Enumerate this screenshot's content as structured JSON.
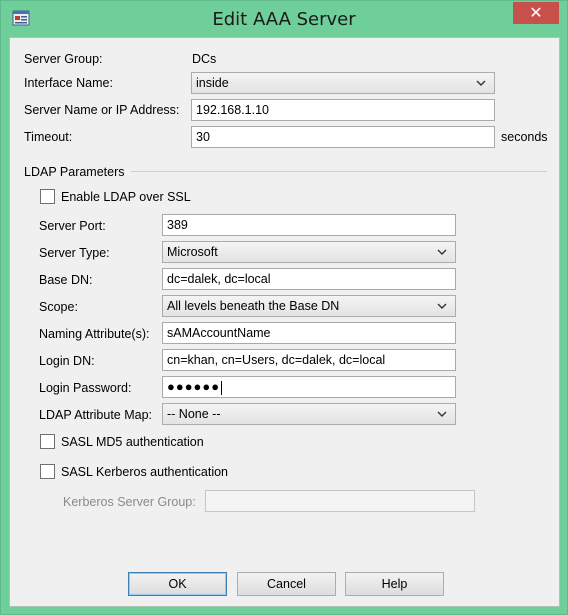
{
  "window": {
    "title": "Edit AAA Server",
    "close_glyph": "✕"
  },
  "server_group": {
    "label": "Server Group:",
    "value": "DCs"
  },
  "interface_name": {
    "label": "Interface Name:",
    "value": "inside"
  },
  "server_name": {
    "label": "Server Name or IP Address:",
    "value": "192.168.1.10"
  },
  "timeout": {
    "label": "Timeout:",
    "value": "30",
    "unit": "seconds"
  },
  "ldap": {
    "group_title": "LDAP Parameters",
    "enable_ssl": {
      "label": "Enable LDAP over SSL",
      "checked": false
    },
    "server_port": {
      "label": "Server Port:",
      "value": "389"
    },
    "server_type": {
      "label": "Server Type:",
      "value": "Microsoft"
    },
    "base_dn": {
      "label": "Base DN:",
      "value": "dc=dalek, dc=local"
    },
    "scope": {
      "label": "Scope:",
      "value": "All levels beneath the Base DN"
    },
    "naming_attribute": {
      "label": "Naming Attribute(s):",
      "value": "sAMAccountName"
    },
    "login_dn": {
      "label": "Login DN:",
      "value": "cn=khan, cn=Users, dc=dalek, dc=local"
    },
    "login_password": {
      "label": "Login Password:",
      "value": "●●●●●●"
    },
    "attribute_map": {
      "label": "LDAP Attribute Map:",
      "value": "-- None --"
    },
    "sasl_md5": {
      "label": "SASL MD5 authentication",
      "checked": false
    },
    "sasl_kerberos": {
      "label": "SASL Kerberos authentication",
      "checked": false
    },
    "kerberos_group": {
      "label": "Kerberos Server Group:",
      "value": ""
    }
  },
  "buttons": {
    "ok": "OK",
    "cancel": "Cancel",
    "help": "Help"
  },
  "colors": {
    "frame": "#6fcf9a",
    "close": "#c7504a",
    "client": "#f0f0f0"
  }
}
